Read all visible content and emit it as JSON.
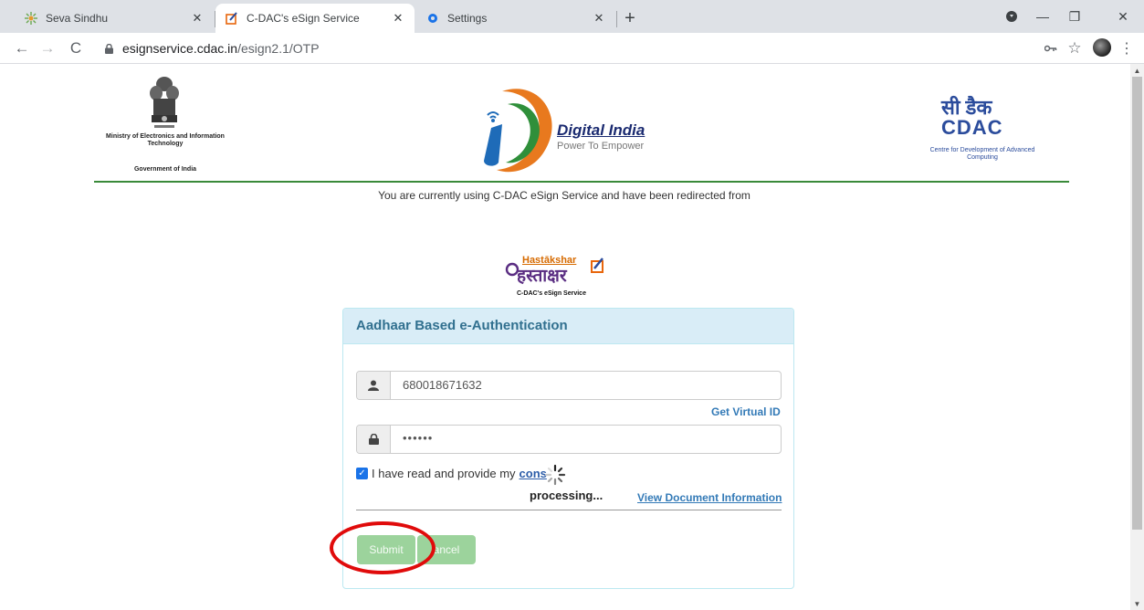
{
  "browser": {
    "tabs": [
      {
        "title": "Seva Sindhu",
        "icon": "seva-sindhu-favicon",
        "active": false
      },
      {
        "title": "C-DAC's eSign Service",
        "icon": "esign-favicon",
        "active": true
      },
      {
        "title": "Settings",
        "icon": "gear-icon",
        "active": false
      }
    ],
    "url_host": "esignservice.cdac.in",
    "url_path": "/esign2.1/OTP"
  },
  "header": {
    "ministry_caption": "Ministry of Electronics and Information Technology",
    "ministry_gov": "Government of India",
    "digital_india_title": "Digital India",
    "digital_india_tagline": "Power To Empower",
    "cdac_hindi": "सी डैक",
    "cdac_logo_text": "CDAC",
    "cdac_caption": "Centre for Development of Advanced Computing"
  },
  "redirect_text": "You are currently using C-DAC eSign Service and have been redirected from",
  "hastakshar": {
    "en": "Hastākshar",
    "hi": "हस्ताक्षर",
    "caption": "C-DAC's eSign Service"
  },
  "panel": {
    "title": "Aadhaar Based e-Authentication",
    "aadhaar_value": "680018671632",
    "get_virtual_id": "Get Virtual ID",
    "otp_value": "••••••",
    "consent_text": "I have read and provide my",
    "consent_link": "cons",
    "consent_checked": true,
    "processing_text": "processing...",
    "view_document": "View Document Information",
    "submit_label": "Submit",
    "cancel_label": "ancel"
  },
  "colors": {
    "panel_heading_bg": "#d9edf7",
    "panel_title": "#31708f",
    "link": "#337ab7",
    "button_disabled": "#9cd39c",
    "highlight": "#e00b0b",
    "rule_green": "#3a8a3a"
  }
}
